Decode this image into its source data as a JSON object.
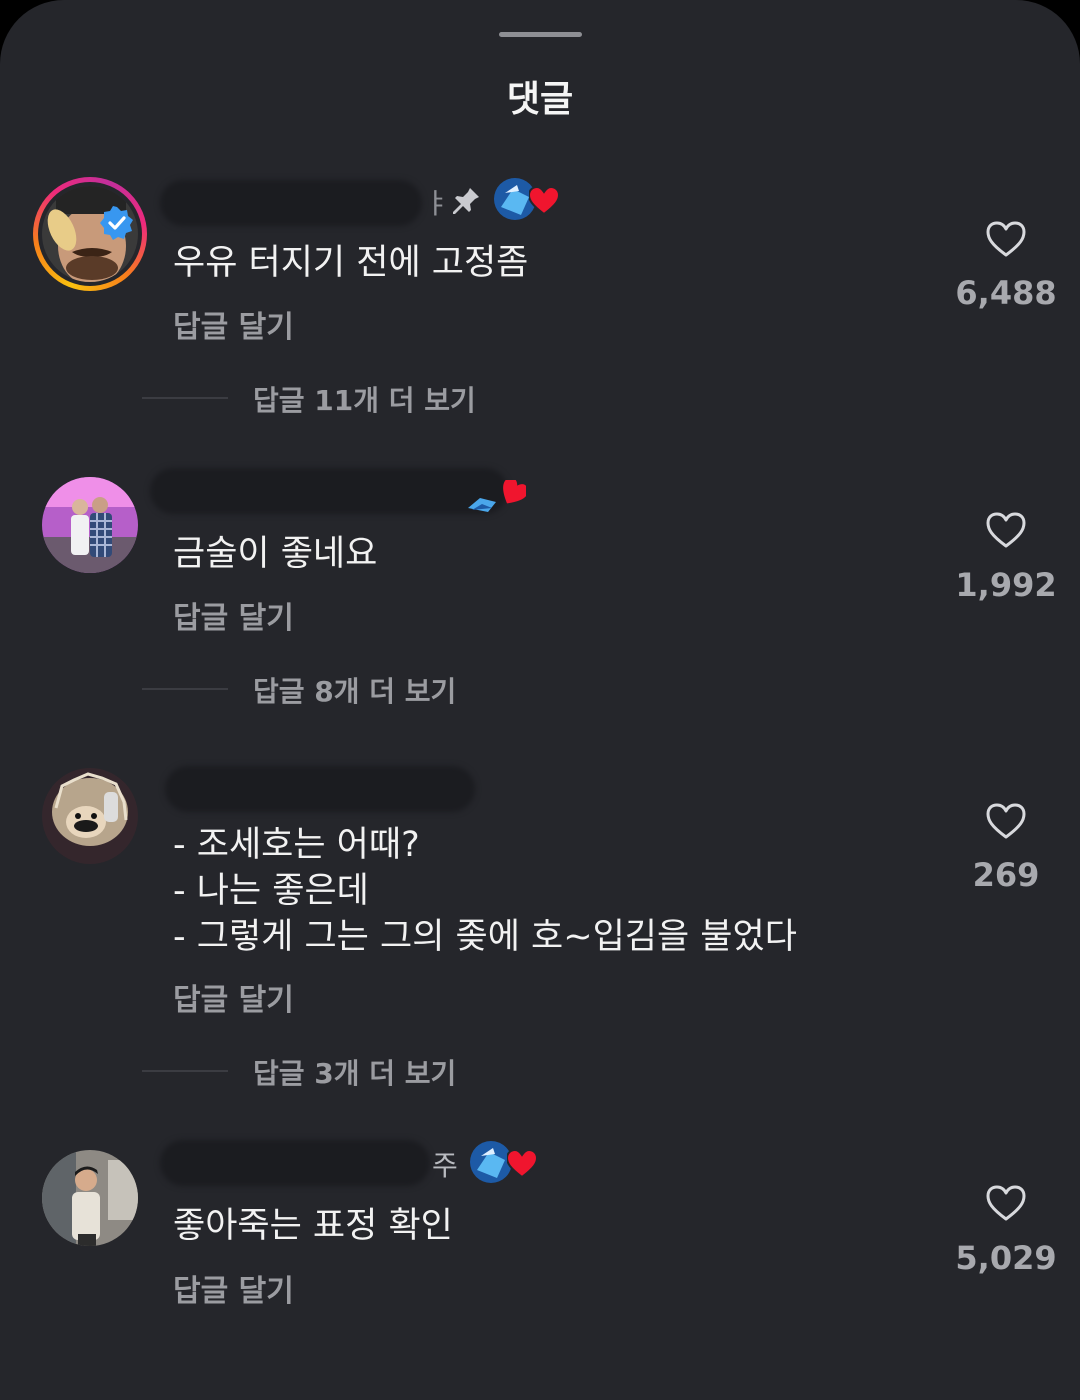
{
  "header": {
    "title": "댓글"
  },
  "comments": [
    {
      "username_tail": "ㅑ",
      "text": "우유 터지기 전에 고정좀",
      "reply_label": "답글 달기",
      "more_replies": "답글 11개 더 보기",
      "likes": "6,488",
      "pinned": true,
      "verified": true
    },
    {
      "username_tail": "",
      "text": "금술이 좋네요",
      "reply_label": "답글 달기",
      "more_replies": "답글 8개 더 보기",
      "likes": "1,992"
    },
    {
      "username_tail": "",
      "text": "- 조세호는 어때?\n- 나는 좋은데\n- 그렇게 그는 그의 좆에 호~입김을 불었다",
      "reply_label": "답글 달기",
      "more_replies": "답글 3개 더 보기",
      "likes": "269"
    },
    {
      "username_tail": "주",
      "text": "좋아죽는 표정 확인",
      "reply_label": "답글 달기",
      "likes": "5,029"
    }
  ],
  "icons": {
    "pin": "pin-icon",
    "heart": "heart-outline-icon",
    "reaction": "creator-liked-heart-icon",
    "verified": "verified-badge-icon"
  },
  "colors": {
    "background": "#25262b",
    "text_primary": "#f2f2f2",
    "text_secondary": "#9b9ca1",
    "reaction_heart": "#f0152e",
    "verified_badge": "#3897f0",
    "story_ring": "#ee2a7b"
  }
}
